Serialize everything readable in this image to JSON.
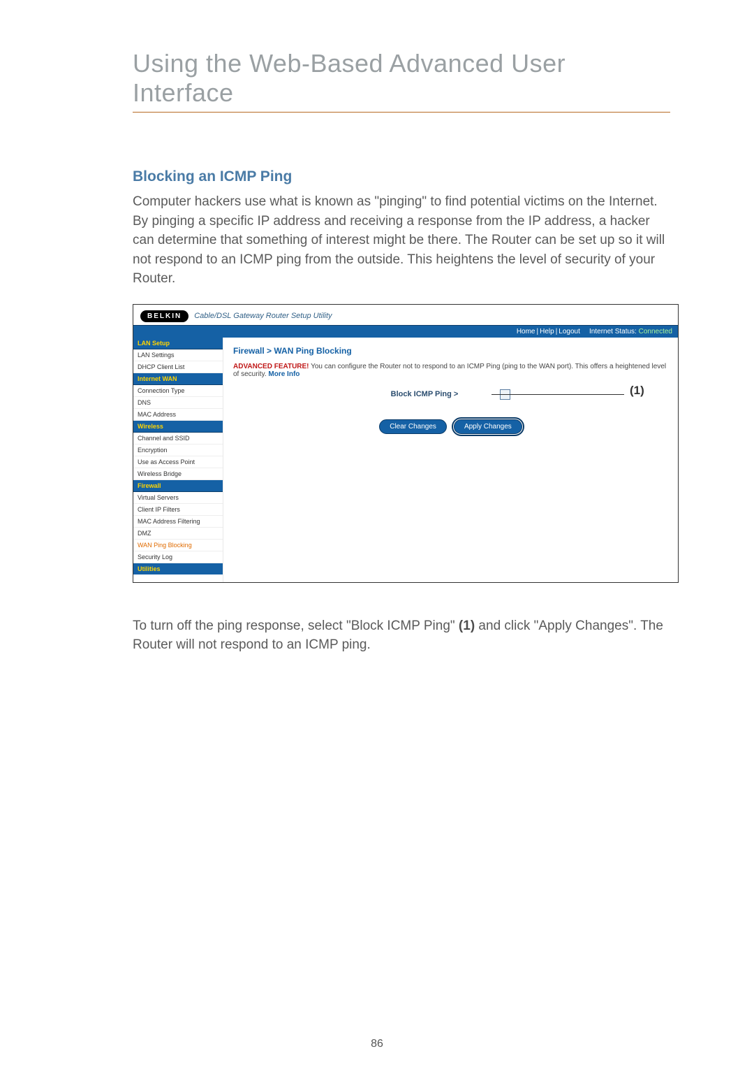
{
  "page": {
    "title": "Using the Web-Based Advanced User Interface",
    "number": "86"
  },
  "section": {
    "heading": "Blocking an ICMP Ping",
    "intro": "Computer hackers use what is known as \"pinging\" to find potential victims on the Internet. By pinging a specific IP address and receiving a response from the IP address, a hacker can determine that something of interest might be there. The Router can be set up so it will not respond to an ICMP ping from the outside. This heightens the level of security of your Router.",
    "outro_pre": "To turn off the ping response, select \"Block ICMP Ping\" ",
    "outro_bold": "(1)",
    "outro_post": " and click \"Apply Changes\". The Router will not respond to an ICMP ping."
  },
  "router": {
    "brand": "BELKIN",
    "product": "Cable/DSL Gateway Router Setup Utility",
    "topbar": {
      "home": "Home",
      "help": "Help",
      "logout": "Logout",
      "status_label": "Internet Status:",
      "status_value": "Connected"
    },
    "sidebar": {
      "cat_lan": "LAN Setup",
      "lan": {
        "settings": "LAN Settings",
        "dhcp": "DHCP Client List"
      },
      "cat_wan": "Internet WAN",
      "wan": {
        "conn": "Connection Type",
        "dns": "DNS",
        "mac": "MAC Address"
      },
      "cat_wireless": "Wireless",
      "wireless": {
        "ssid": "Channel and SSID",
        "enc": "Encryption",
        "ap": "Use as Access Point",
        "bridge": "Wireless Bridge"
      },
      "cat_firewall": "Firewall",
      "firewall": {
        "vs": "Virtual Servers",
        "cip": "Client IP Filters",
        "macf": "MAC Address Filtering",
        "dmz": "DMZ",
        "wanping": "WAN Ping Blocking",
        "seclog": "Security Log"
      },
      "cat_util": "Utilities"
    },
    "content": {
      "breadcrumb": "Firewall > WAN Ping Blocking",
      "adv_label": "ADVANCED FEATURE!",
      "adv_text": " You can configure the Router not to respond to an ICMP Ping (ping to the WAN port). This offers a heightened level of security. ",
      "more_info": "More Info",
      "setting_label": "Block ICMP Ping >",
      "callout": "(1)",
      "btn_clear": "Clear Changes",
      "btn_apply": "Apply Changes"
    }
  }
}
